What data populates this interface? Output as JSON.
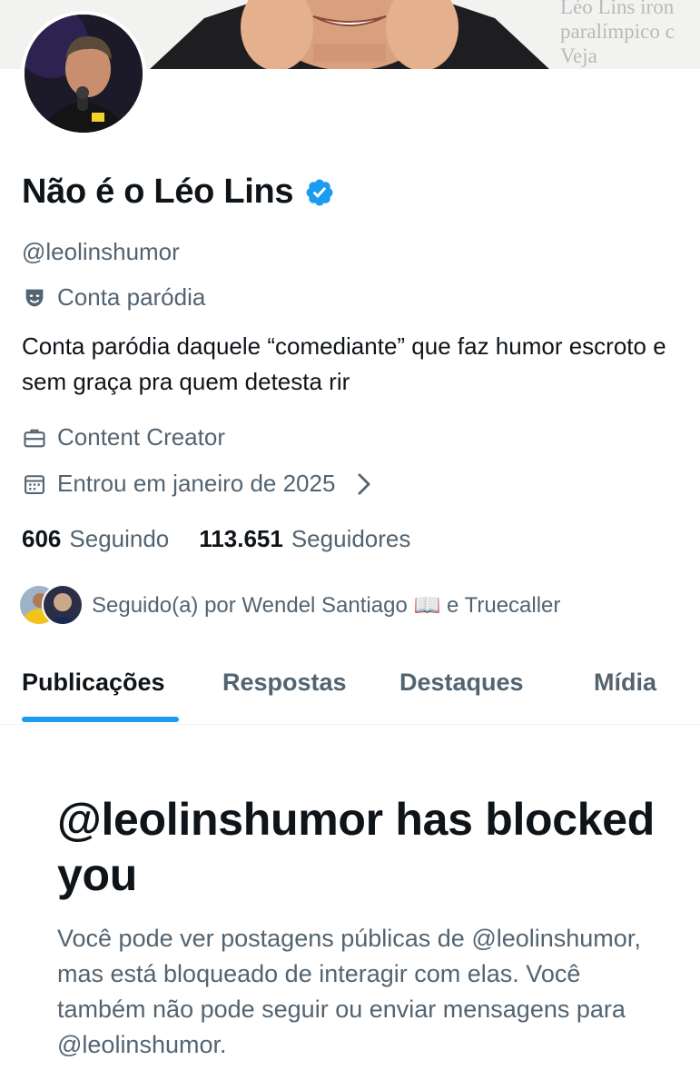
{
  "banner": {
    "text_lines": [
      "Léo Lins iron",
      "paralímpico c",
      "Veja"
    ]
  },
  "profile": {
    "display_name": "Não é o Léo Lins",
    "verified": true,
    "handle": "@leolinshumor",
    "parody_label": "Conta paródia",
    "bio": "Conta paródia daquele “comediante” que faz humor escroto e sem graça pra quem detesta rir",
    "category": "Content Creator",
    "joined": "Entrou em janeiro de 2025"
  },
  "stats": {
    "following_count": "606",
    "following_label": "Seguindo",
    "followers_count": "113.651",
    "followers_label": "Seguidores"
  },
  "followed_by": {
    "text": "Seguido(a) por Wendel Santiago 📖 e Truecaller"
  },
  "tabs": [
    {
      "label": "Publicações",
      "active": true
    },
    {
      "label": "Respostas",
      "active": false
    },
    {
      "label": "Destaques",
      "active": false
    },
    {
      "label": "Mídia",
      "active": false
    }
  ],
  "blocked_notice": {
    "title": "@leolinshumor has blocked you",
    "description": "Você pode ver postagens públicas de @leolinshumor, mas está bloqueado de interagir com elas. Você também não pode seguir ou enviar mensagens para @leolinshumor."
  },
  "icons": {
    "verified": "verified-badge-icon",
    "parody": "theater-mask-icon",
    "category": "briefcase-icon",
    "joined": "calendar-icon",
    "joined_more": "chevron-right-icon"
  },
  "colors": {
    "accent": "#1d9bf0",
    "text_primary": "#0f1419",
    "text_secondary": "#536471"
  }
}
